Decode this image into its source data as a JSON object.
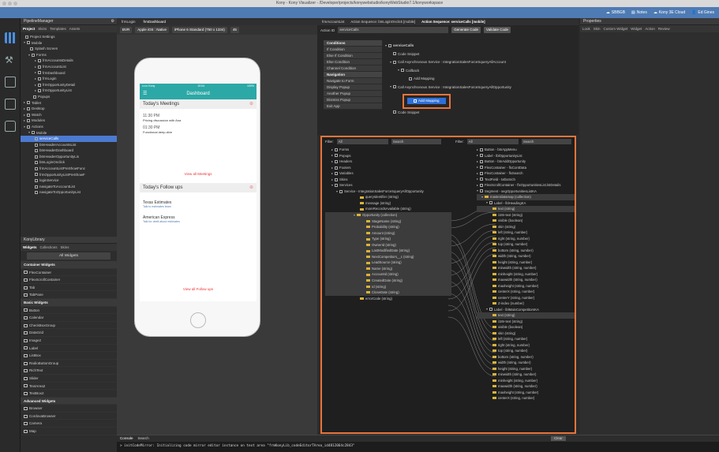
{
  "app": {
    "title": "Kony - Kony Visualizer - /Developer/projects/konywebstudio/konyWebStudio7.1/konyworkspace"
  },
  "topbar": {
    "buttons": [
      "SBBGB",
      "Notes",
      "Kony 3E Cloud",
      "Ed Gines"
    ]
  },
  "pm": {
    "title": "PipelineManager",
    "tabs": [
      "Project",
      "Skins",
      "Templates",
      "Assets"
    ],
    "tree": [
      "Project Settings",
      "Mobile",
      "Splash Screen",
      "Forms",
      "frmAccountsDetails",
      "frmAccountList",
      "frmDashboard",
      "frmLogin",
      "frmOpportunityDetail",
      "frmOpportunityList",
      "Popups",
      "Tablet",
      "Desktop",
      "Watch",
      "Modules",
      "Actions",
      "Mobile",
      "serviceCalls",
      "btnHeaderAccountsList",
      "btnHeaderDashboard",
      "btnHeaderOpportunityLis",
      "btnLoginOnclick",
      "frmAccountListPreShowFunc",
      "frmOpportunityListPreShowF",
      "loginService",
      "navigateToAccountList",
      "navigateToOpportunityList"
    ]
  },
  "lib": {
    "title": "KonyLibrary",
    "tabs": [
      "Widgets",
      "Collections",
      "Skins"
    ],
    "filter": "All Widgets",
    "items": [
      {
        "s": 1,
        "t": "Container Widgets"
      },
      {
        "t": "FlexContainer"
      },
      {
        "t": "FlexScrollContainer"
      },
      {
        "t": "Tab"
      },
      {
        "t": "TabPane"
      },
      {
        "s": 1,
        "t": "Basic Widgets"
      },
      {
        "t": "Button"
      },
      {
        "t": "Calendar"
      },
      {
        "t": "CheckBoxGroup"
      },
      {
        "t": "DataGrid"
      },
      {
        "t": "Image2"
      },
      {
        "t": "Label"
      },
      {
        "t": "ListBox"
      },
      {
        "t": "RadioButtonGroup"
      },
      {
        "t": "RichText"
      },
      {
        "t": "Slider"
      },
      {
        "t": "TextArea2"
      },
      {
        "t": "TextBox2"
      },
      {
        "s": 1,
        "t": "Advanced Widgets"
      },
      {
        "t": "Browser"
      },
      {
        "t": "CordovaBrowser"
      },
      {
        "t": "Camera"
      },
      {
        "t": "Map"
      }
    ]
  },
  "editor": {
    "tabs": [
      "frmLogin",
      "frmDashboard"
    ],
    "mode": "BVR",
    "platform": "Apple iOS : Native",
    "device": "iPhone 6 Standard (750 x 1334)",
    "zoom": "45"
  },
  "phone": {
    "carrier": "•••••• Kony",
    "time": "10:04",
    "battery": "100%",
    "header": "Dashboard",
    "meetings_title": "Today's Meetings",
    "meetings": [
      {
        "time": "11:30 PM",
        "desc": "Pricing discussion with Ana"
      },
      {
        "time": "01:30 PM",
        "desc": "Functional deep-dive"
      }
    ],
    "view_meetings": "View all Meetings",
    "followups_title": "Today's Follow ups",
    "followups": [
      {
        "name": "Texas Estimates",
        "desc": "Talk to estimates team"
      },
      {
        "name": "American Express",
        "desc": "Talk for deelt about estimates"
      }
    ],
    "view_followups": "View all Follow ups"
  },
  "action": {
    "tabs": [
      "frmAccountList",
      "Action Sequence: btnLoginOnclick [mobile]",
      "Action Sequence: serviceCalls [mobile]"
    ],
    "id_label": "Action ID",
    "id_value": "serviceCalls",
    "gen": "Generate Code",
    "validate": "Validate Code",
    "categories": [
      {
        "h": 1,
        "t": "Conditions"
      },
      {
        "t": "If Condition"
      },
      {
        "t": "Else If Condition"
      },
      {
        "t": "Else Condition"
      },
      {
        "t": "Channel Condition"
      },
      {
        "h": 1,
        "t": "Navigation"
      },
      {
        "t": "Navigate to Form"
      },
      {
        "t": "Display Popup"
      },
      {
        "t": "Another Popup"
      },
      {
        "t": "Dismiss Popup"
      },
      {
        "t": "Exit App"
      }
    ],
    "seq": [
      "serviceCalls",
      "Code Snippet",
      "Call Asynchronous Service : IntegrationSalesForceSqueryAllAccount",
      "Callback",
      "Add Mapping",
      "Call Asynchronous Service : IntegrationSalesForceSqueryAllOpportunity",
      "Add Mapping",
      "Code Snippet"
    ]
  },
  "mapper": {
    "filter_label": "Filter:",
    "filter_value": "All",
    "search": "Search",
    "left": [
      "Forms",
      "Popups",
      "Headers",
      "Footers",
      "Variables",
      "Skins",
      "Services",
      "Service - IntegrationSalesForceSqueryAllOpportunity",
      "queryIdentifier (string)",
      "message (string)",
      "moreRecordsAvailable (string)",
      "Opportunity (collection)",
      "StageName (string)",
      "Probability (string)",
      "Amount (string)",
      "Type (string)",
      "OwnerId (string)",
      "LastModifiedDate (string)",
      "NextCompetitors__c (string)",
      "LeadSource (string)",
      "Name (string)",
      "AccountId (string)",
      "CreatedDate (string)",
      "Id (string)",
      "CloseDate (string)",
      "errorCode (string)"
    ],
    "right": [
      "Button - btnAppMenu",
      "Label - lblOpportunityList",
      "Button - btnAddOpportunity",
      "FlexContainer - flxContData",
      "FlexContainer - flxSearch",
      "TextField - txtbxSrch",
      "FlexScrollContainer - flxOpportunitiesList.lstDetails",
      "Segment - segOpportunitiesListKA",
      "masterdatamap (collection)",
      "Label - lblHeadingKA",
      "text (string)",
      "i18n-text (string)",
      "visible (boolean)",
      "skin (string)",
      "left (string, number)",
      "right (string, number)",
      "top (string, number)",
      "bottom (string, number)",
      "width (string, number)",
      "height (string, number)",
      "minwidth (string, number)",
      "minheight (string, number)",
      "maxwidth (string, number)",
      "maxheight (string, number)",
      "centerX (string, number)",
      "centerY (string, number)",
      "Z-index (number)",
      "Label - lblMainCompetitorsKA",
      "text (string)",
      "i18n-text (string)",
      "visible (boolean)",
      "skin (string)",
      "left (string, number)",
      "right (string, number)",
      "top (string, number)",
      "bottom (string, number)",
      "width (string, number)",
      "height (string, number)",
      "minwidth (string, number)",
      "minheight (string, number)",
      "maxwidth (string, number)",
      "maxheight (string, number)",
      "centerX (string, number)"
    ]
  },
  "props": {
    "title": "Properties",
    "tabs": [
      "Look",
      "Skin",
      "Custom Widget",
      "Widget",
      "Action",
      "Review"
    ]
  },
  "console": {
    "tabs": [
      "Console",
      "Search"
    ],
    "clear": "Clear",
    "text": "> initCodeMirror: Initializing code mirror editor instance on text area \"frmKonyLib_codeEditorTArea_id4812064c2843\""
  }
}
